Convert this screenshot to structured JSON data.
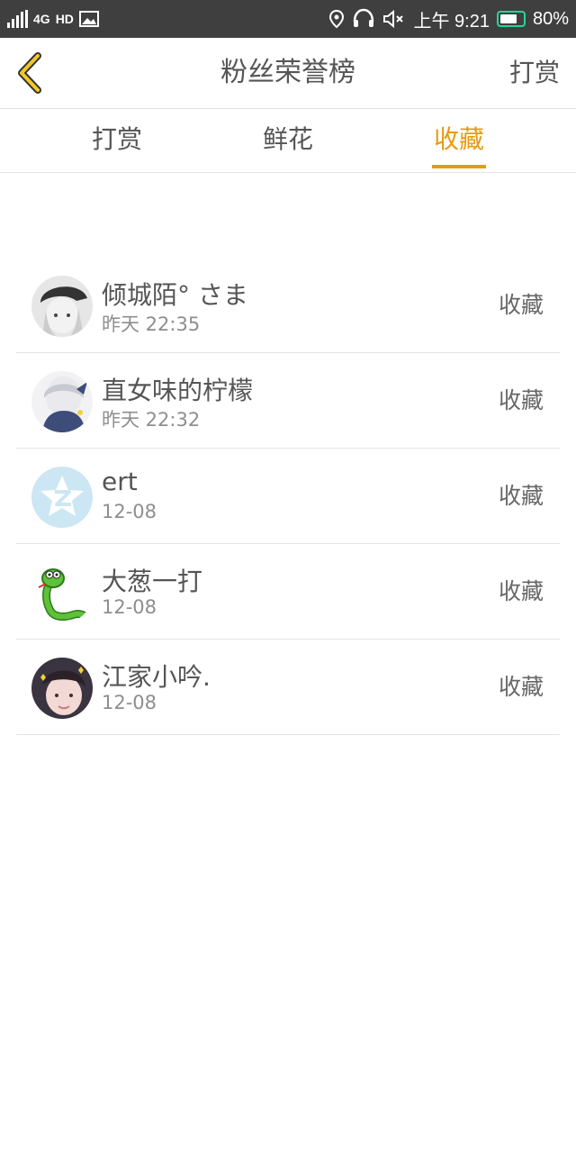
{
  "status_bar": {
    "network": "4G",
    "hd": "HD",
    "time": "上午 9:21",
    "battery": "80%",
    "battery_level": 0.8,
    "accent": "#2bd39a"
  },
  "nav": {
    "back_icon": "chevron-left-icon",
    "title": "粉丝荣誉榜",
    "right_action": "打赏"
  },
  "tabs": [
    {
      "label": "打赏",
      "active": false
    },
    {
      "label": "鲜花",
      "active": false
    },
    {
      "label": "收藏",
      "active": true
    }
  ],
  "colors": {
    "accent": "#e89a12",
    "text": "#555555",
    "subtext": "#8e8e8e"
  },
  "list": [
    {
      "name": "倾城陌° さま",
      "time": "昨天 22:35",
      "action": "收藏"
    },
    {
      "name": "直女味的柠檬",
      "time": "昨天 22:32",
      "action": "收藏"
    },
    {
      "name": "ert",
      "time": "12-08",
      "action": "收藏"
    },
    {
      "name": "大葱一打",
      "time": "12-08",
      "action": "收藏"
    },
    {
      "name": "江家小吟.",
      "time": "12-08",
      "action": "收藏"
    }
  ]
}
